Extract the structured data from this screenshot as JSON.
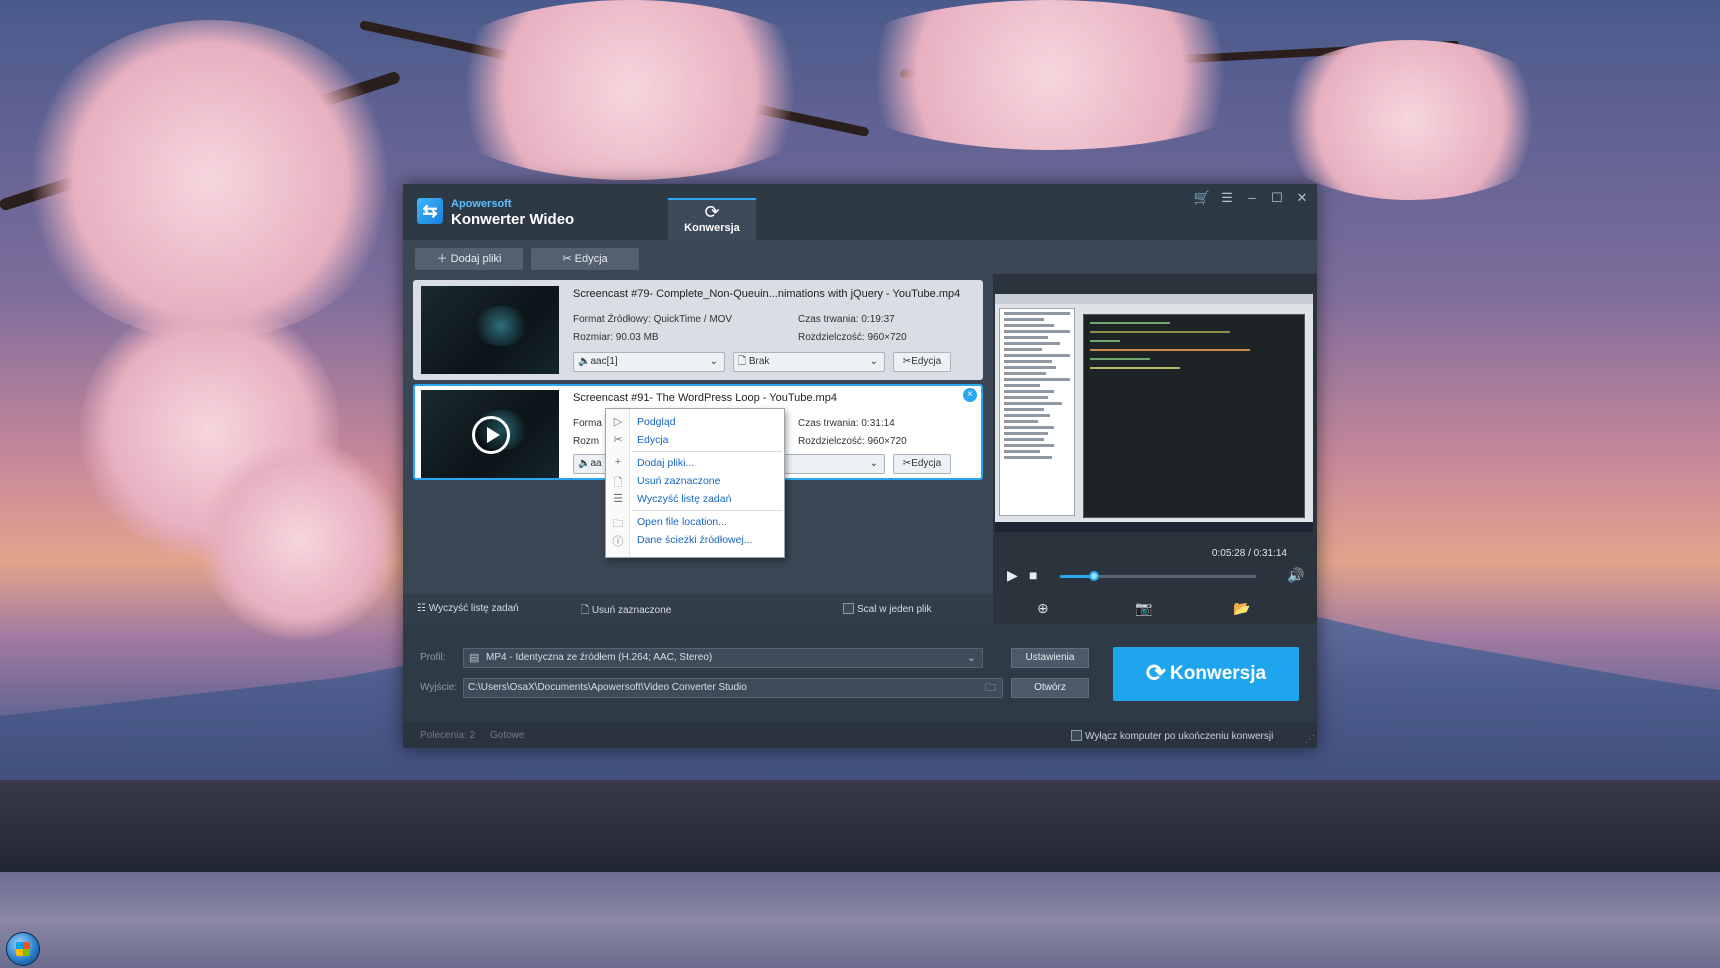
{
  "app": {
    "brand_small": "Apowersoft",
    "brand_title": "Konwerter Wideo",
    "tab_label": "Konwersja"
  },
  "toolbar": {
    "add_files": "Dodaj pliki",
    "edit": "Edycja"
  },
  "items": [
    {
      "name": "Screencast #79- Complete_Non-Queuin...nimations with jQuery - YouTube.mp4",
      "format": "Format Źródłowy: QuickTime / MOV",
      "size": "Rozmiar: 90.03 MB",
      "duration": "Czas trwania: 0:19:37",
      "resolution": "Rozdzielczość: 960×720",
      "audio": "aac[1]",
      "subtitle": "Brak",
      "edit": "Edycja"
    },
    {
      "name": "Screencast #91- The WordPress Loop - YouTube.mp4",
      "format_partial": "Forma",
      "size_partial": "Rozm",
      "duration": "Czas trwania: 0:31:14",
      "resolution": "Rozdzielczość: 960×720",
      "audio_partial": "aa",
      "edit": "Edycja",
      "close": "×"
    }
  ],
  "context_menu": [
    {
      "icon": "▷",
      "label": "Podgląd"
    },
    {
      "icon": "✂",
      "label": "Edycja"
    },
    {
      "icon": "+",
      "label": "Dodaj pliki..."
    },
    {
      "icon": "🗋",
      "label": "Usuń zaznaczone"
    },
    {
      "icon": "☰",
      "label": "Wyczyść listę zadań"
    },
    {
      "icon": "🗀",
      "label": "Open file location..."
    },
    {
      "icon": "ⓘ",
      "label": "Dane ścieżki źródłowej..."
    }
  ],
  "preview": {
    "time": "0:05:28 / 0:31:14",
    "progress": 0.175
  },
  "actions": {
    "clear_list": "Wyczyść listę zadań",
    "remove_selected": "Usuń zaznaczone",
    "merge": "Scal w jeden plik"
  },
  "bottom": {
    "profile_label": "Profil:",
    "profile_value": "MP4 - Identyczna ze źródłem (H.264; AAC, Stereo)",
    "output_label": "Wyjście:",
    "output_value": "C:\\Users\\OsaX\\Documents\\Apowersoft\\Video Converter Studio",
    "settings": "Ustawienia",
    "open": "Otwórz",
    "convert": "Konwersja"
  },
  "status": {
    "tasks": "Polecenia: 2",
    "state": "Gotowe",
    "shutdown": "Wyłącz komputer po ukończeniu konwersji"
  },
  "colors": {
    "accent": "#1fa5ee",
    "window_bg": "#2f3a47",
    "menu_link": "#1565c0"
  }
}
